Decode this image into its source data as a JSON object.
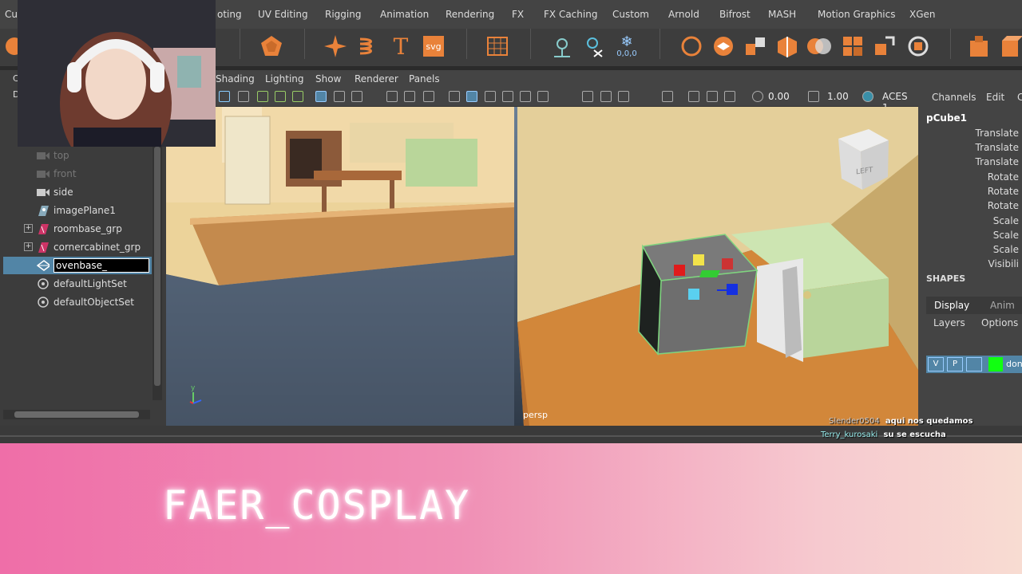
{
  "shelf_tabs": [
    "Cu",
    "oting",
    "UV Editing",
    "Rigging",
    "Animation",
    "Rendering",
    "FX",
    "FX Caching",
    "Custom",
    "Arnold",
    "Bifrost",
    "MASH",
    "Motion Graphics",
    "XGen"
  ],
  "shelf_text": {
    "svg": "svg",
    "text_tool": "T",
    "snow_value": "0,0,0"
  },
  "panel_menu": [
    "Shading",
    "Lighting",
    "Show",
    "Renderer",
    "Panels"
  ],
  "view_toolbar": {
    "exposure": "0.00",
    "gamma": "1.00",
    "color_space": "ACES 1."
  },
  "outliner_stub": {
    "c": "C",
    "d": "D"
  },
  "outliner": [
    {
      "label": "top",
      "dim": true,
      "icon": "camera-icon"
    },
    {
      "label": "front",
      "dim": true,
      "icon": "camera-icon"
    },
    {
      "label": "side",
      "dim": false,
      "icon": "camera-icon"
    },
    {
      "label": "imagePlane1",
      "dim": false,
      "icon": "image-plane-icon"
    },
    {
      "label": "roombase_grp",
      "dim": false,
      "icon": "group-icon",
      "expand": "+"
    },
    {
      "label": "cornercabinet_grp",
      "dim": false,
      "icon": "group-icon",
      "expand": "+"
    },
    {
      "label": "ovenbase_",
      "dim": false,
      "icon": "mesh-icon",
      "editing": true
    },
    {
      "label": "defaultLightSet",
      "dim": false,
      "icon": "set-icon"
    },
    {
      "label": "defaultObjectSet",
      "dim": false,
      "icon": "set-icon"
    }
  ],
  "viewport": {
    "camera_label": "persp",
    "viewcube_label": "LEFT",
    "axis_y": "y"
  },
  "channel_box": {
    "menu": [
      "Channels",
      "Edit",
      "C"
    ],
    "object": "pCube1",
    "attributes": [
      "Translate",
      "Translate",
      "Translate",
      "Rotate",
      "Rotate",
      "Rotate",
      "Scale",
      "Scale",
      "Scale",
      "Visibili"
    ],
    "shapes_label": "SHAPES",
    "tabs": [
      "Display",
      "Anim"
    ],
    "sub_menu": [
      "Layers",
      "Options"
    ],
    "layer": {
      "v": "V",
      "p": "P",
      "name": "don"
    }
  },
  "chat": [
    {
      "user": "Slender0504",
      "message": "aqui nos quedamos"
    },
    {
      "user": "Terry_kurosaki",
      "message": "su se escucha"
    }
  ],
  "streamer_name": "FAER_COSPLAY",
  "colors": {
    "accent": "#5285a6",
    "banner_pink": "#ef6ea8",
    "selection_green": "#7fd47f",
    "floor": "#d2873a"
  }
}
